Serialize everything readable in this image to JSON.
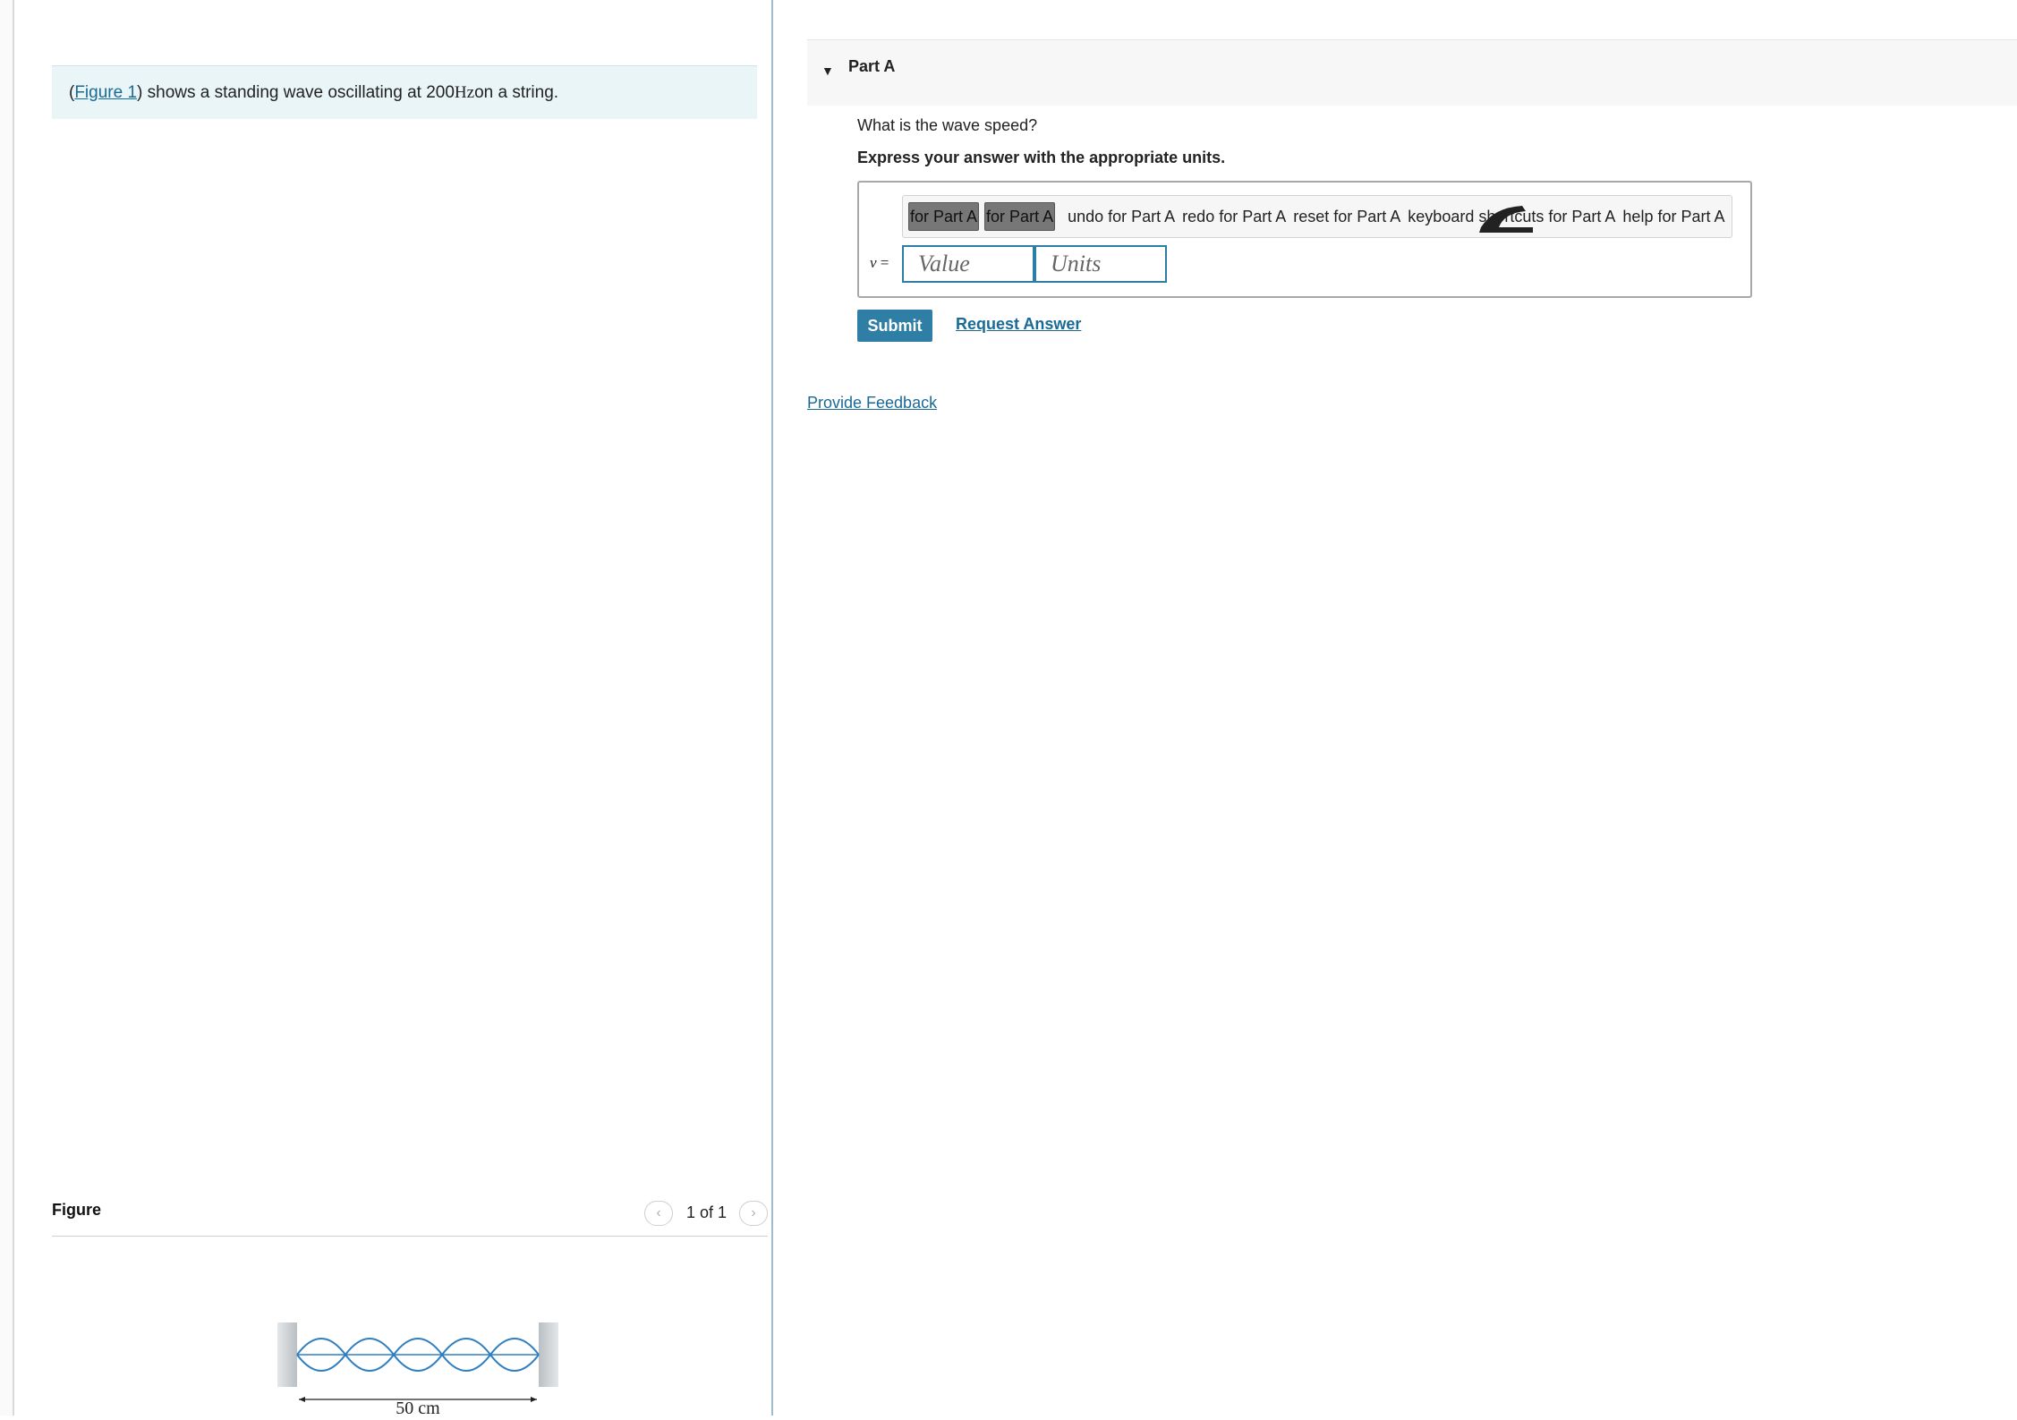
{
  "intro": {
    "open_paren": "(",
    "figure_link": "Figure 1",
    "text_before_hz": ") shows a standing wave oscillating at 200 ",
    "unit_hz": "Hz",
    "text_after_hz": " on a string."
  },
  "figure_panel": {
    "title": "Figure",
    "pager": "1 of 1",
    "prev_icon": "chevron-left-icon",
    "next_icon": "chevron-right-icon",
    "length_label": "50 cm",
    "antinode_count": 5,
    "colors": {
      "wave": "#2f7fc1",
      "wall": "#c8cdd0"
    }
  },
  "part": {
    "title": "Part A",
    "question": "What is the wave speed?",
    "instruction": "Express your answer with the appropriate units.",
    "toolbar": {
      "templates_label": "for Part A",
      "symbols_label": "for Part A",
      "undo_label": "undo for Part A",
      "redo_label": "redo for Part A",
      "reset_label": "reset for Part A",
      "shortcuts_label": "keyboard shortcuts for Part A",
      "help_label": "help for Part A"
    },
    "variable": "v",
    "equals": " =",
    "value_placeholder": "Value",
    "units_placeholder": "Units",
    "submit_label": "Submit",
    "request_label": "Request Answer"
  },
  "feedback_label": "Provide Feedback",
  "colors": {
    "accent": "#2e7ea5",
    "link": "#1a6a96",
    "intro_bg": "#eaf5f7"
  }
}
